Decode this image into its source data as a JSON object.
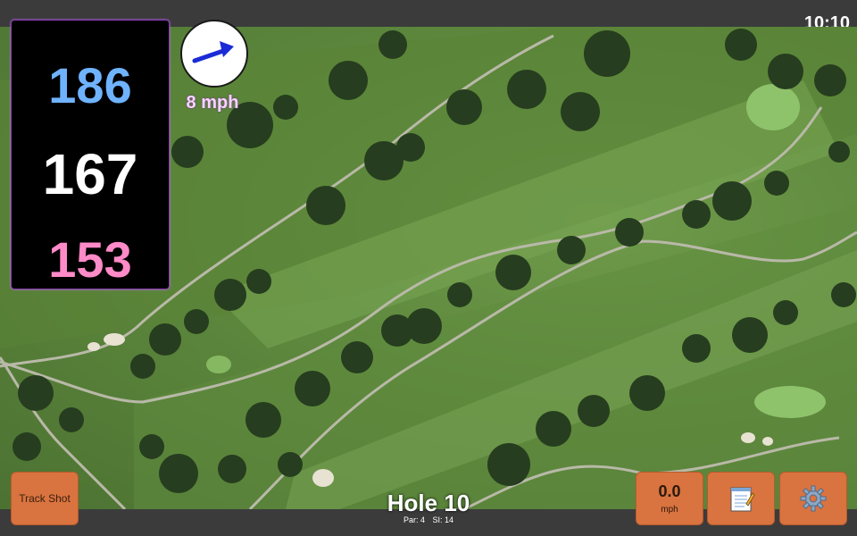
{
  "status": {
    "time": "10:10"
  },
  "distances": {
    "back": "186",
    "middle": "167",
    "front": "153"
  },
  "wind": {
    "speed_label": "8 mph",
    "icon": "wind-arrow-icon"
  },
  "hole": {
    "title": "Hole 10",
    "par_label": "Par: 4",
    "si_label": "SI: 14"
  },
  "buttons": {
    "track_shot": "Track Shot",
    "wind_value": "0.0",
    "wind_unit": "mph",
    "notes_icon": "notepad-icon",
    "settings_icon": "gear-icon"
  },
  "colors": {
    "back_distance": "#6fb3ff",
    "middle_distance": "#ffffff",
    "front_distance": "#ff8ac8",
    "button": "#d9733f",
    "panel_border": "#8a3bb0"
  }
}
